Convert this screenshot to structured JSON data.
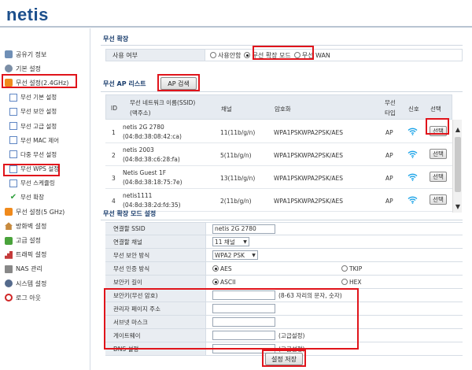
{
  "brand": {
    "logo": "netis"
  },
  "sidebar": {
    "items": [
      {
        "label": "공유기 정보",
        "icon": "info-icon",
        "level": "top"
      },
      {
        "label": "기본 설정",
        "icon": "settings-icon",
        "level": "top"
      },
      {
        "label": "무선 설정(2.4GHz)",
        "icon": "wireless-icon",
        "level": "top"
      },
      {
        "label": "무선 기본 설정",
        "icon": "document-icon",
        "level": "sub"
      },
      {
        "label": "무선 보안 설정",
        "icon": "document-icon",
        "level": "sub"
      },
      {
        "label": "무선 고급 설정",
        "icon": "document-icon",
        "level": "sub"
      },
      {
        "label": "무선 MAC 제어",
        "icon": "document-icon",
        "level": "sub"
      },
      {
        "label": "다중 무선 설정",
        "icon": "document-icon",
        "level": "sub"
      },
      {
        "label": "무선 WPS 설정",
        "icon": "document-icon",
        "level": "sub"
      },
      {
        "label": "무선 스케쥴링",
        "icon": "document-icon",
        "level": "sub"
      },
      {
        "label": "무선 확장",
        "icon": "check-icon",
        "level": "sub"
      },
      {
        "label": "무선 설정(5 GHz)",
        "icon": "wireless-icon",
        "level": "top"
      },
      {
        "label": "방화벽 설정",
        "icon": "firewall-icon",
        "level": "top"
      },
      {
        "label": "고급 설정",
        "icon": "puzzle-icon",
        "level": "top"
      },
      {
        "label": "트래픽 설정",
        "icon": "chart-icon",
        "level": "top"
      },
      {
        "label": "NAS 관리",
        "icon": "nas-icon",
        "level": "top"
      },
      {
        "label": "시스템 설정",
        "icon": "system-icon",
        "level": "top"
      },
      {
        "label": "로그 아웃",
        "icon": "power-icon",
        "level": "top"
      }
    ]
  },
  "extend": {
    "title": "무선 확장",
    "usage_label": "사용 여부",
    "options": [
      "사용안함",
      "무선 확장 모드",
      "무선 WAN"
    ],
    "selected": "무선 확장 모드"
  },
  "aplist": {
    "title": "무선 AP 리스트",
    "scan_button": "AP 검색",
    "headers": {
      "id": "ID",
      "ssid": "무선 네트워크 이름(SSID)",
      "mac": "(맥주소)",
      "channel": "채널",
      "security": "암호화",
      "type1": "무선",
      "type2": "타입",
      "signal": "신호",
      "select": "선택"
    },
    "select_button": "선택",
    "rows": [
      {
        "id": "1",
        "ssid": "netis 2G 2780",
        "mac": "(04:8d:38:08:42:ca)",
        "channel": "11(11b/g/n)",
        "security": "WPA1PSKWPA2PSK/AES",
        "type": "AP"
      },
      {
        "id": "2",
        "ssid": "netis 2003",
        "mac": "(04:8d:38:c6:28:fa)",
        "channel": "5(11b/g/n)",
        "security": "WPA1PSKWPA2PSK/AES",
        "type": "AP"
      },
      {
        "id": "3",
        "ssid": "Netis Guest 1F",
        "mac": "(04:8d:38:18:75:7e)",
        "channel": "13(11b/g/n)",
        "security": "WPA1PSKWPA2PSK/AES",
        "type": "AP"
      },
      {
        "id": "4",
        "ssid": "netis1111",
        "mac": "(04:8d:38:2d:fd:35)",
        "channel": "2(11b/g/n)",
        "security": "WPA1PSKWPA2PSK/AES",
        "type": "AP"
      }
    ]
  },
  "mode": {
    "title": "무선 확장 모드 설정",
    "ssid_label": "연결할 SSID",
    "ssid_value": "netis 2G 2780",
    "channel_label": "연결할 채널",
    "channel_value": "11 채널",
    "security_label": "무선 보안 방식",
    "security_value": "WPA2 PSK",
    "auth_label": "무선 인증 방식",
    "auth_options": [
      "AES",
      "TKIP"
    ],
    "auth_selected": "AES",
    "keylen_label": "보안키 길이",
    "keylen_options": [
      "ASCII",
      "HEX"
    ],
    "keylen_selected": "ASCII",
    "key_label": "보안키(무선 암호)",
    "key_hint": "(8-63 자리의 문자, 숫자)",
    "admin_label": "관리자 페이지 주소",
    "subnet_label": "서브넷 마스크",
    "gateway_label": "게이트웨이",
    "gateway_hint": "(고급설정)",
    "dns_label": "DNS 설정",
    "dns_hint": "(고급설정)",
    "save_button": "설정 저장"
  },
  "colors": {
    "highlight": "#e0141b",
    "brand": "#1c4f8c",
    "wifi": "#1aa3e8"
  }
}
